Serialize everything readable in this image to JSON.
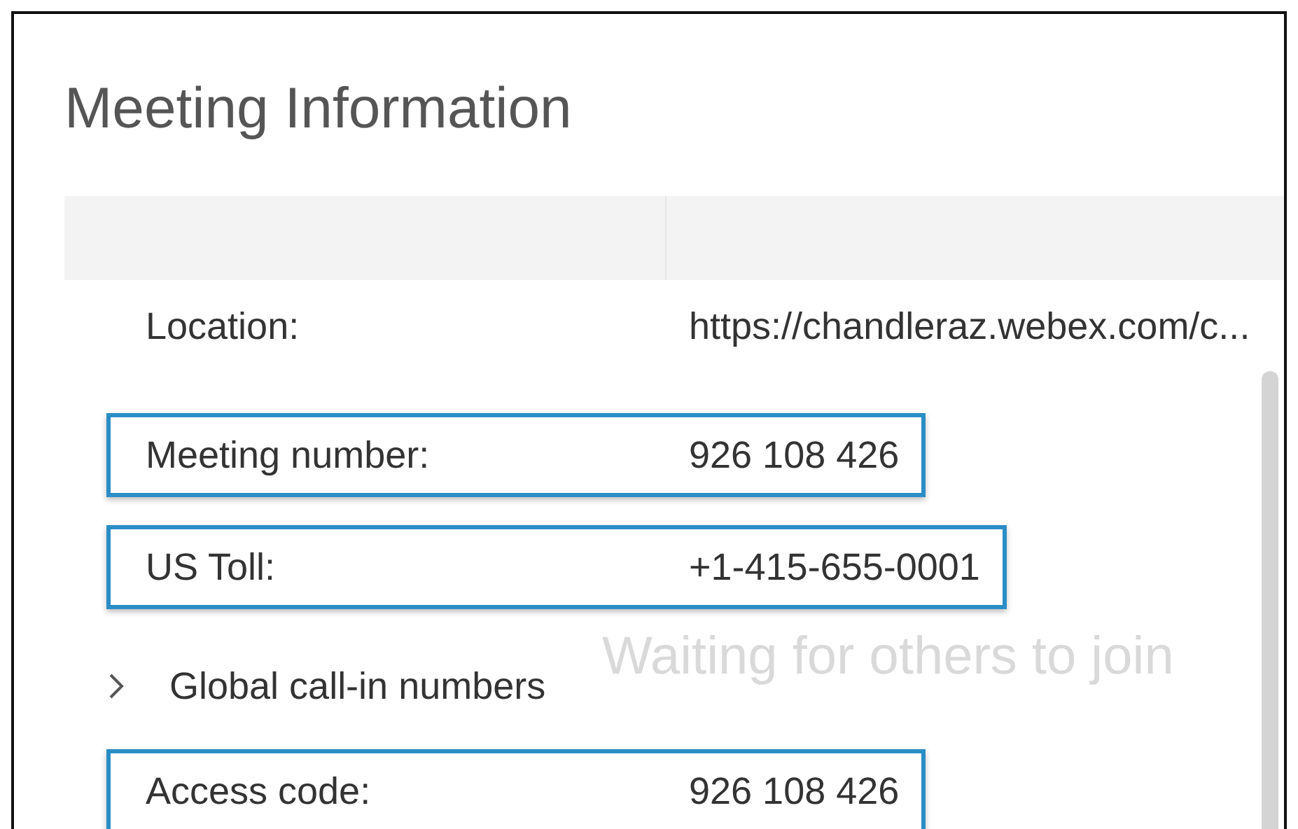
{
  "window": {
    "title": "Meeting Information"
  },
  "background_message": "Waiting for others to join",
  "rows": [
    {
      "kind": "field",
      "label": "Location:",
      "value": "https://chandleraz.webex.com/c...",
      "highlighted": false
    },
    {
      "kind": "field",
      "label": "Meeting number:",
      "value": "926 108 426",
      "highlighted": true
    },
    {
      "kind": "field",
      "label": "US Toll:",
      "value": "+1-415-655-0001",
      "highlighted": true
    },
    {
      "kind": "expander",
      "label": "Global call-in numbers",
      "expanded": false
    },
    {
      "kind": "field",
      "label": "Access code:",
      "value": "926 108 426",
      "highlighted": true
    }
  ]
}
